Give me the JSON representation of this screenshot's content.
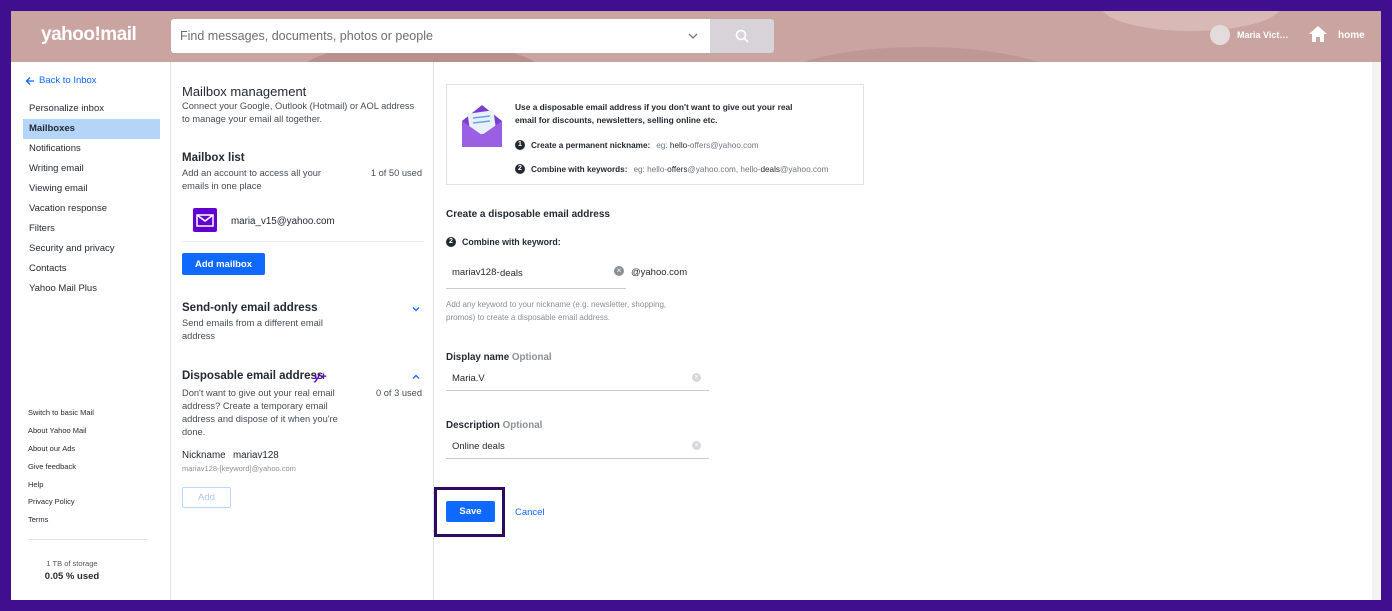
{
  "header": {
    "logo": "yahoo!mail",
    "search_placeholder": "Find messages, documents, photos or people",
    "user_name": "Maria Victoria",
    "home_label": "home"
  },
  "leftnav": {
    "back_label": "Back to Inbox",
    "items": [
      {
        "label": "Personalize inbox",
        "active": false
      },
      {
        "label": "Mailboxes",
        "active": true
      },
      {
        "label": "Notifications",
        "active": false
      },
      {
        "label": "Writing email",
        "active": false
      },
      {
        "label": "Viewing email",
        "active": false
      },
      {
        "label": "Vacation response",
        "active": false
      },
      {
        "label": "Filters",
        "active": false
      },
      {
        "label": "Security and privacy",
        "active": false
      },
      {
        "label": "Contacts",
        "active": false
      },
      {
        "label": "Yahoo Mail Plus",
        "active": false
      }
    ],
    "footer_links": [
      "Switch to basic Mail",
      "About Yahoo Mail",
      "About our Ads",
      "Give feedback",
      "Help",
      "Privacy Policy",
      "Terms"
    ],
    "storage_label": "1 TB of storage",
    "storage_used": "0.05 % used"
  },
  "mailbox_mgmt": {
    "title": "Mailbox management",
    "desc": "Connect your Google, Outlook (Hotmail) or AOL address to manage your email all together.",
    "list_title": "Mailbox list",
    "list_desc": "Add an account to access all your emails in one place",
    "list_count": "1 of 50 used",
    "mailbox_email": "maria_v15@yahoo.com",
    "add_mailbox_label": "Add mailbox",
    "send_only_title": "Send-only email address",
    "send_only_desc": "Send emails from a different email address",
    "disposable_title": "Disposable email address",
    "disposable_badge": "y+",
    "disposable_desc": "Don't want to give out your real email address? Create a temporary email address and dispose of it when you're done.",
    "disposable_count": "0 of 3 used",
    "nickname_label": "Nickname",
    "nickname_value": "mariav128",
    "nickname_template": "mariav128-[keyword]@yahoo.com",
    "add_label": "Add"
  },
  "disposable_form": {
    "intro": "Use a disposable email address if you don't want to give out your real email for discounts, newsletters, selling online etc.",
    "step1_label": "Create a permanent nickname:",
    "step1_eg": "eg:",
    "step1_example_a": "hello-",
    "step1_example_b": "offers@yahoo.com",
    "step2_label": "Combine with keywords:",
    "step2_eg": "eg:",
    "step2_example_1a": "hello-",
    "step2_example_1b": "offers",
    "step2_example_1c": "@yahoo.com,",
    "step2_example_2a": "hello-",
    "step2_example_2b": "deals",
    "step2_example_2c": "@yahoo.com",
    "create_title": "Create a disposable email address",
    "combine_label": "Combine with keyword:",
    "keyword_prefix": "mariav128-",
    "keyword_value": "deals",
    "domain": "@yahoo.com",
    "keyword_help": "Add any keyword to your nickname (e.g. newsletter, shopping, promos) to create a disposable email address.",
    "display_name_label": "Display name",
    "display_name_optional": "Optional",
    "display_name_value": "Maria.V",
    "description_label": "Description",
    "description_optional": "Optional",
    "description_value": "Online deals",
    "save_label": "Save",
    "cancel_label": "Cancel"
  },
  "step_numbers": {
    "one": "1",
    "two": "2"
  },
  "colors": {
    "accent": "#0f69ff",
    "brand": "#6001d2",
    "active_nav": "#b4d4f8",
    "page_border": "#3f0f8f",
    "header_bg": "#c9a4a1"
  }
}
